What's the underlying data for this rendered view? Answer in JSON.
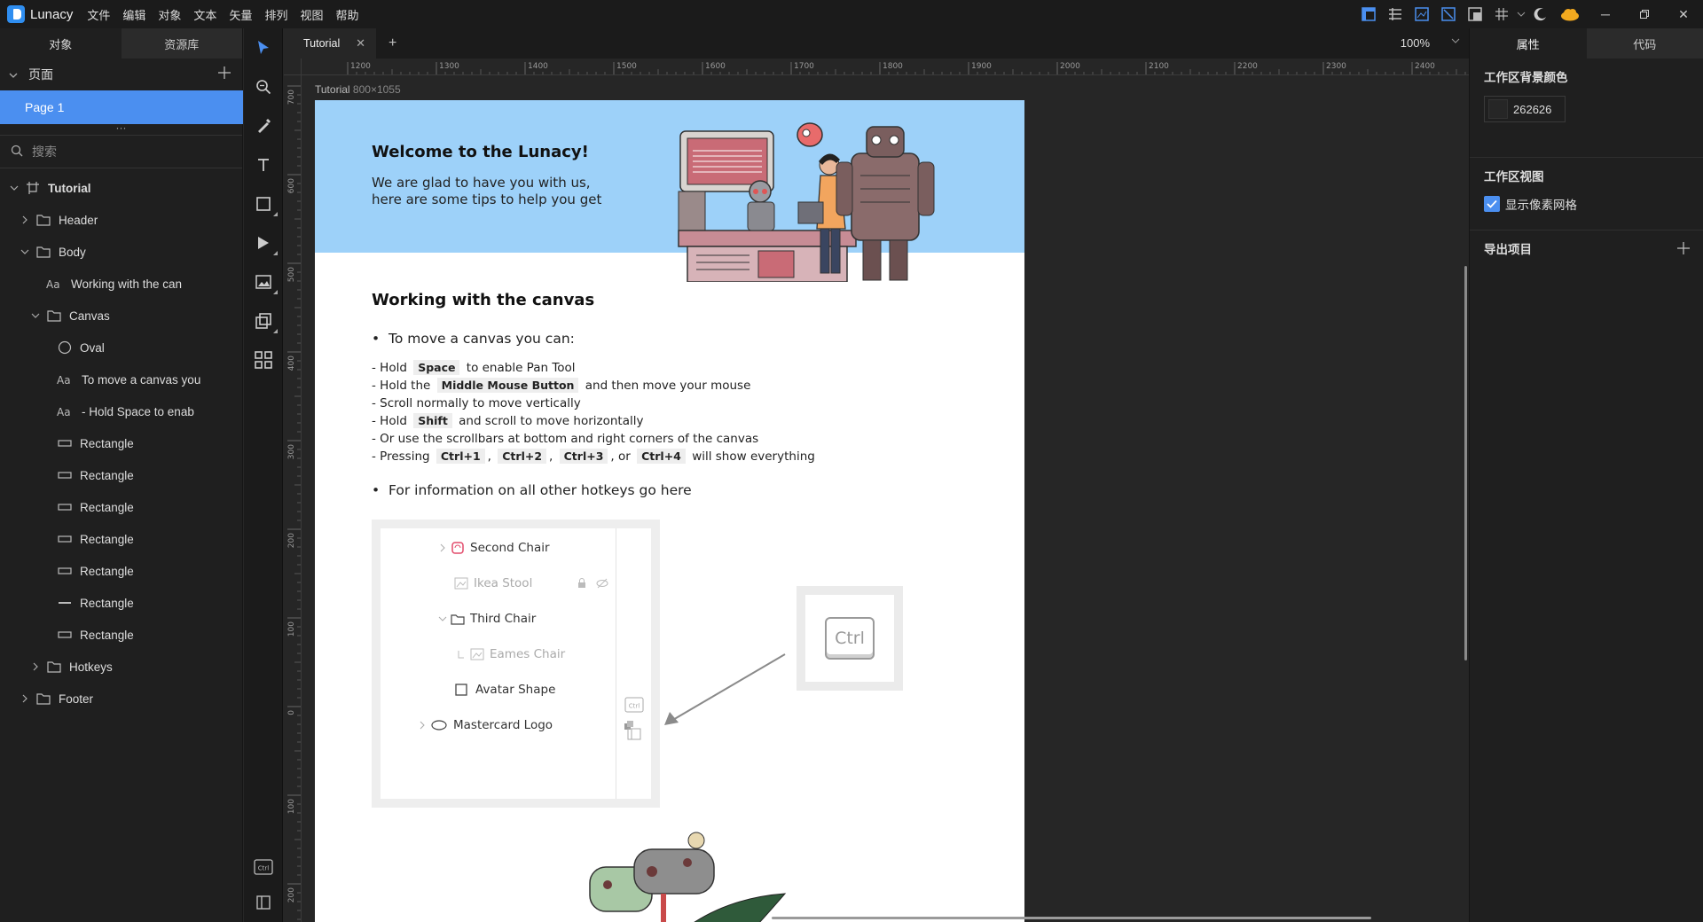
{
  "app": {
    "name": "Lunacy",
    "menu": [
      "文件",
      "编辑",
      "对象",
      "文本",
      "矢量",
      "排列",
      "视图",
      "帮助"
    ]
  },
  "left_panel": {
    "tabs": [
      "对象",
      "资源库"
    ],
    "pages_label": "页面",
    "pages": [
      "Page 1"
    ],
    "search_placeholder": "搜索",
    "layers": [
      {
        "label": "Tutorial",
        "icon": "artboard-icon",
        "depth": 0,
        "expanded": true
      },
      {
        "label": "Header",
        "icon": "folder-icon",
        "depth": 1,
        "expanded": false
      },
      {
        "label": "Body",
        "icon": "folder-icon",
        "depth": 1,
        "expanded": true
      },
      {
        "label": "Working with the can",
        "icon": "text-icon",
        "depth": 2
      },
      {
        "label": "Canvas",
        "icon": "folder-icon",
        "depth": 2,
        "expanded": true
      },
      {
        "label": "Oval",
        "icon": "oval-icon",
        "depth": 3
      },
      {
        "label": "To move a canvas you",
        "icon": "text-icon",
        "depth": 3
      },
      {
        "label": "- Hold Space to enab",
        "icon": "text-icon",
        "depth": 3
      },
      {
        "label": "Rectangle",
        "icon": "rectangle-icon",
        "depth": 3
      },
      {
        "label": "Rectangle",
        "icon": "rectangle-icon",
        "depth": 3
      },
      {
        "label": "Rectangle",
        "icon": "rectangle-icon",
        "depth": 3
      },
      {
        "label": "Rectangle",
        "icon": "rectangle-icon",
        "depth": 3
      },
      {
        "label": "Rectangle",
        "icon": "rectangle-icon",
        "depth": 3
      },
      {
        "label": "Rectangle",
        "icon": "line-icon",
        "depth": 3
      },
      {
        "label": "Rectangle",
        "icon": "rectangle-icon",
        "depth": 3
      },
      {
        "label": "Hotkeys",
        "icon": "folder-icon",
        "depth": 2,
        "expanded": false
      },
      {
        "label": "Footer",
        "icon": "folder-icon",
        "depth": 1,
        "expanded": false
      }
    ]
  },
  "tools": [
    "select-tool-icon",
    "zoom-tool-icon",
    "pen-tool-icon",
    "text-tool-icon",
    "rectangle-tool-icon",
    "path-tool-icon",
    "image-tool-icon",
    "boolean-tool-icon",
    "components-tool-icon"
  ],
  "tabbar": {
    "doc_tab": "Tutorial",
    "zoom": "100%"
  },
  "rulers": {
    "h_ticks": [
      "1200",
      "1300",
      "1400",
      "1500",
      "1600",
      "1700",
      "1800",
      "1900",
      "2000",
      "2100",
      "2200",
      "2300",
      "2400"
    ],
    "v_ticks": [
      "700",
      "600",
      "500",
      "400",
      "300",
      "200",
      "100",
      "0",
      "100",
      "200"
    ]
  },
  "canvas": {
    "artboard_name": "Tutorial",
    "artboard_size": "800×1055",
    "header_title": "Welcome to the Lunacy!",
    "header_sub_1": "We are glad to have you with us,",
    "header_sub_2": "here are some tips to help you get",
    "section_title": "Working with the canvas",
    "bullet_1": "To move a canvas you can:",
    "bullet_2": "For information on all other hotkeys go here",
    "lines": {
      "l1_a": "- Hold",
      "l1_k": "Space",
      "l1_b": "to enable Pan Tool",
      "l2_a": "- Hold the",
      "l2_k": "Middle Mouse Button",
      "l2_b": "and then move your mouse",
      "l3": "- Scroll normally to move vertically",
      "l4_a": "- Hold",
      "l4_k": "Shift",
      "l4_b": "and scroll to move horizontally",
      "l5": "- Or use the scrollbars at bottom and right corners of the canvas",
      "l6_a": "- Pressing",
      "l6_k1": "Ctrl+1",
      "l6_c1": ",",
      "l6_k2": "Ctrl+2",
      "l6_c2": ",",
      "l6_k3": "Ctrl+3",
      "l6_c3": ", or",
      "l6_k4": "Ctrl+4",
      "l6_b": "will show everything"
    },
    "mock_rows": [
      "Second Chair",
      "Ikea Stool",
      "Third Chair",
      "Eames Chair",
      "Avatar Shape",
      "Mastercard Logo"
    ],
    "mock_ctrl": "Ctrl",
    "ctrl_key": "Ctrl"
  },
  "right_panel": {
    "tabs": [
      "属性",
      "代码"
    ],
    "bg_color_label": "工作区背景颜色",
    "bg_color_hex": "262626",
    "view_label": "工作区视图",
    "pixel_grid_label": "显示像素网格",
    "pixel_grid_checked": true,
    "export_label": "导出项目"
  },
  "bottom_tools": {
    "ctrl_label": "Ctrl"
  },
  "colors": {
    "accent": "#4b8ff0",
    "header_bg": "#9dd1f9",
    "canvas_bg": "#262626"
  }
}
